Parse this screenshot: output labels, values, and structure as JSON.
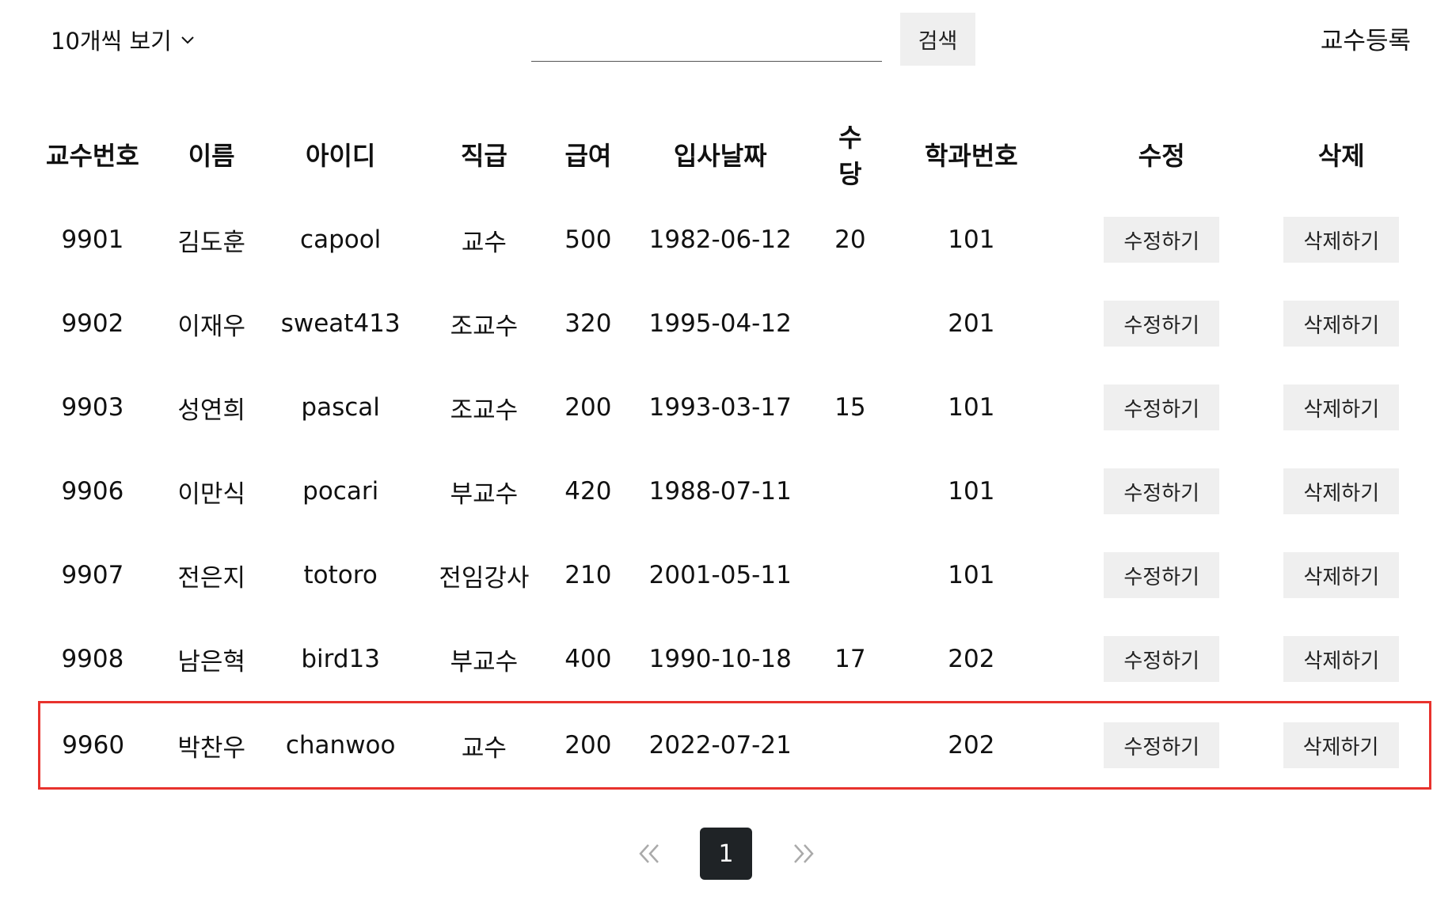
{
  "toolbar": {
    "page_size_label": "10개씩 보기",
    "search_value": "",
    "search_button_label": "검색",
    "register_label": "교수등록"
  },
  "table": {
    "columns": [
      "교수번호",
      "이름",
      "아이디",
      "직급",
      "급여",
      "입사날짜",
      "수당",
      "학과번호",
      "수정",
      "삭제"
    ],
    "rows": [
      {
        "no": "9901",
        "name": "김도훈",
        "id": "capool",
        "position": "교수",
        "pay": "500",
        "hiredate": "1982-06-12",
        "bonus": "20",
        "deptno": "101",
        "edit": "수정하기",
        "delete": "삭제하기"
      },
      {
        "no": "9902",
        "name": "이재우",
        "id": "sweat413",
        "position": "조교수",
        "pay": "320",
        "hiredate": "1995-04-12",
        "bonus": "",
        "deptno": "201",
        "edit": "수정하기",
        "delete": "삭제하기"
      },
      {
        "no": "9903",
        "name": "성연희",
        "id": "pascal",
        "position": "조교수",
        "pay": "200",
        "hiredate": "1993-03-17",
        "bonus": "15",
        "deptno": "101",
        "edit": "수정하기",
        "delete": "삭제하기"
      },
      {
        "no": "9906",
        "name": "이만식",
        "id": "pocari",
        "position": "부교수",
        "pay": "420",
        "hiredate": "1988-07-11",
        "bonus": "",
        "deptno": "101",
        "edit": "수정하기",
        "delete": "삭제하기"
      },
      {
        "no": "9907",
        "name": "전은지",
        "id": "totoro",
        "position": "전임강사",
        "pay": "210",
        "hiredate": "2001-05-11",
        "bonus": "",
        "deptno": "101",
        "edit": "수정하기",
        "delete": "삭제하기"
      },
      {
        "no": "9908",
        "name": "남은혁",
        "id": "bird13",
        "position": "부교수",
        "pay": "400",
        "hiredate": "1990-10-18",
        "bonus": "17",
        "deptno": "202",
        "edit": "수정하기",
        "delete": "삭제하기"
      },
      {
        "no": "9960",
        "name": "박찬우",
        "id": "chanwoo",
        "position": "교수",
        "pay": "200",
        "hiredate": "2022-07-21",
        "bonus": "",
        "deptno": "202",
        "edit": "수정하기",
        "delete": "삭제하기"
      }
    ]
  },
  "pagination": {
    "current_page": "1"
  },
  "colors": {
    "highlight_border": "#e8322d",
    "button_bg": "#efefef",
    "active_page_bg": "#1f2326"
  },
  "icons": {
    "page_size_chevron": "chevron-down-icon",
    "prev": "double-chevron-left-icon",
    "next": "double-chevron-right-icon"
  }
}
